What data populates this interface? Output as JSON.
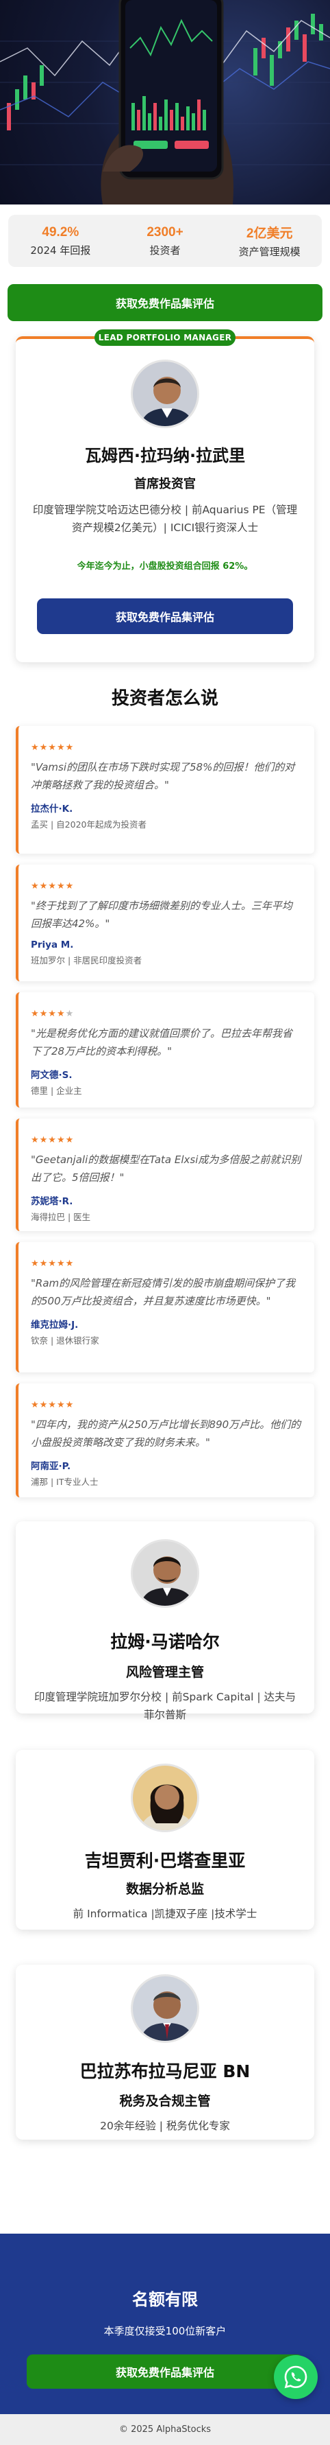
{
  "stats": [
    {
      "value": "49.2%",
      "label": "2024 年回报"
    },
    {
      "value": "2300+",
      "label": "投资者"
    },
    {
      "value": "2亿美元",
      "label": "资产管理规模"
    }
  ],
  "cta_label": "获取免费作品集评估",
  "lead": {
    "badge": "LEAD PORTFOLIO MANAGER",
    "name": "瓦姆西·拉玛纳·拉武里",
    "role": "首席投资官",
    "credentials": "印度管理学院艾哈迈达巴德分校 | 前Aquarius PE（管理资产规模2亿美元）| ICICI银行资深人士",
    "performance": "今年迄今为止，小盘股投资组合回报 62%。",
    "button": "获取免费作品集评估"
  },
  "testimonials_title": "投资者怎么说",
  "testimonials": [
    {
      "stars": 5,
      "quote": "\"Vamsi的团队在市场下跌时实现了58%的回报！他们的对冲策略拯救了我的投资组合。\"",
      "name": "拉杰什·K.",
      "desc": "孟买 | 自2020年起成为投资者"
    },
    {
      "stars": 5,
      "quote": "\"终于找到了了解印度市场细微差别的专业人士。三年平均回报率达42%。\"",
      "name": "Priya M.",
      "desc": "班加罗尔 | 非居民印度投资者"
    },
    {
      "stars": 4,
      "quote": "\"光是税务优化方面的建议就值回票价了。巴拉去年帮我省下了28万卢比的资本利得税。\"",
      "name": "阿文德·S.",
      "desc": "德里 | 企业主"
    },
    {
      "stars": 5,
      "quote": "\"Geetanjali的数据模型在Tata Elxsi成为多倍股之前就识别出了它。5倍回报！\"",
      "name": "苏妮塔·R.",
      "desc": "海得拉巴 | 医生"
    },
    {
      "stars": 5,
      "quote": "\"Ram的风险管理在新冠疫情引发的股市崩盘期间保护了我的500万卢比投资组合，并且复苏速度比市场更快。\"",
      "name": "维克拉姆·J.",
      "desc": "钦奈 | 退休银行家"
    },
    {
      "stars": 5,
      "quote": "\"四年内，我的资产从250万卢比增长到890万卢比。他们的小盘股投资策略改变了我的财务未来。\"",
      "name": "阿南亚·P.",
      "desc": "浦那 | IT专业人士"
    }
  ],
  "team": [
    {
      "name": "拉姆·马诺哈尔",
      "role": "风险管理主管",
      "credentials": "印度管理学院班加罗尔分校 | 前Spark Capital | 达夫与菲尔普斯"
    },
    {
      "name": "吉坦贾利·巴塔查里亚",
      "role": "数据分析总监",
      "credentials": "前 Informatica |凯捷双子座 |技术学士"
    },
    {
      "name": "巴拉苏布拉马尼亚 BN",
      "role": "税务及合规主管",
      "credentials": "20余年经验 | 税务优化专家"
    }
  ],
  "footer_cta": {
    "title": "名额有限",
    "subtitle": "本季度仅接受100位新客户",
    "button": "获取免费作品集评估"
  },
  "copyright": "© 2025 AlphaStocks",
  "colors": {
    "accent": "#f07e28",
    "green": "#1e8c16",
    "navy": "#1f3a8e"
  }
}
